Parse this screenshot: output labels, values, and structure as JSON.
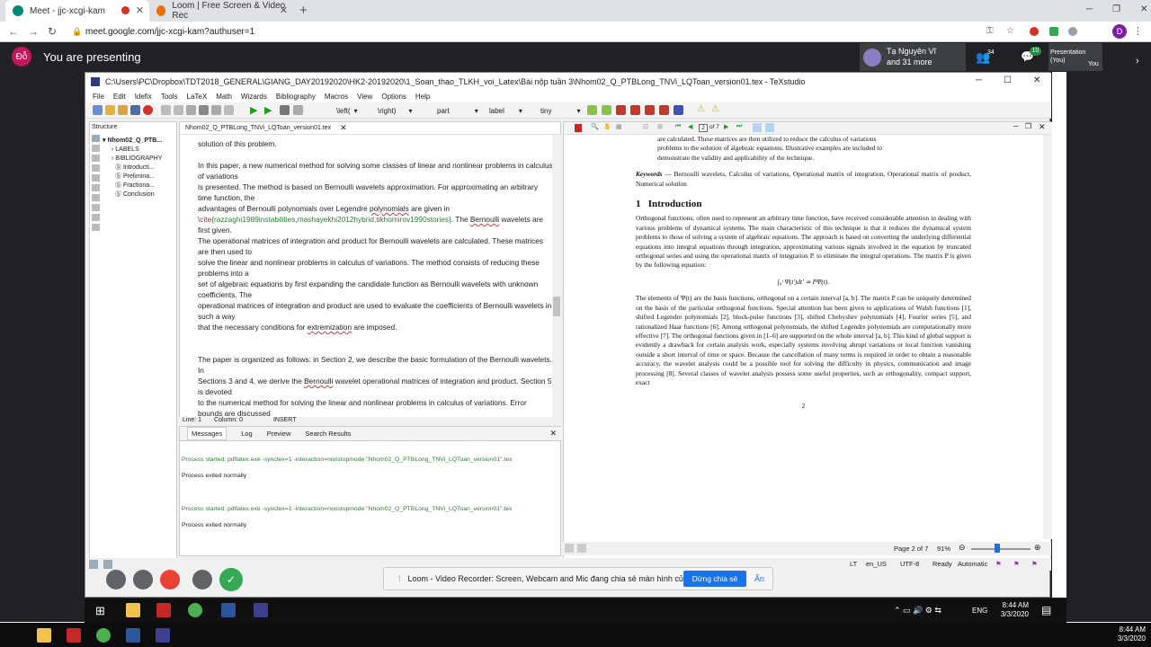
{
  "browser": {
    "tabs": [
      {
        "label": "Meet - jjc-xcgi-kam",
        "active": true
      },
      {
        "label": "Loom | Free Screen & Video Rec",
        "active": false
      }
    ],
    "url": "meet.google.com/jjc-xcgi-kam?authuser=1",
    "profile_letter": "D"
  },
  "meet": {
    "presenter_initials": "Đỗ",
    "presenting_text": "You are presenting",
    "participant_name": "Tạ Nguyên Vĩ",
    "participant_more": "and 31 more",
    "people_count": "34",
    "chat_count": "10",
    "presentation_label": "Presentation (You)",
    "you_label": "You"
  },
  "texstudio": {
    "title": "C:\\Users\\PC\\Dropbox\\TDT2018_GENERAL\\GIANG_DAY20192020\\HK2-20192020\\1_Soan_thao_TLKH_voi_Latex\\Bài nộp tuần 3\\Nhom02_Q_PTBLong_TNVi_LQToan_version01.tex - TeXstudio",
    "menu": [
      "File",
      "Edit",
      "Idefix",
      "Tools",
      "LaTeX",
      "Math",
      "Wizards",
      "Bibliography",
      "Macros",
      "View",
      "Options",
      "Help"
    ],
    "toolbar_dropdowns": [
      "\\left(",
      "\\right)",
      "part",
      "label",
      "tiny"
    ],
    "structure": {
      "header": "Structure",
      "root": "Nhom02_Q_PTB...",
      "items": [
        "LABELS",
        "BIBLIOGRAPHY",
        "Introducti...",
        "Prelimina...",
        "Fractiona...",
        "Conclusion"
      ]
    },
    "editor": {
      "tab": "Nhom02_Q_PTBLong_TNVi_LQToan_version01.tex",
      "status_line": "Line: 1",
      "status_col": "Column: 0",
      "status_mode": "INSERT"
    },
    "messages": {
      "tabs": [
        "Messages",
        "Log",
        "Preview",
        "Search Results"
      ],
      "lines": [
        "Process started: pdflatex.exe -synctex=1 -interaction=nonstopmode \"Nhom02_Q_PTBLong_TNVi_LQToan_version01\".tex",
        "Process exited normally",
        "Process started: pdflatex.exe -synctex=1 -interaction=nonstopmode \"Nhom02_Q_PTBLong_TNVi_LQToan_version01\".tex",
        "Process exited normally"
      ]
    },
    "pdf": {
      "page_box": "2",
      "page_of": "of 7",
      "status_page": "Page 2 of 7",
      "zoom": "91%",
      "abstract_end": [
        "are calculated. These matrices are then utilized to reduce the calculus of variations",
        "problems to the solution of algebraic equations. Illustrative examples are included to",
        "demonstrate the validity and applicability of the technique."
      ],
      "keywords_label": "Keywords",
      "keywords": "— Bernoulli wavelets, Calculus of variations, Operational matrix of integration, Operational matrix of product, Numerical solution",
      "section_num": "1",
      "section_title": "Introduction",
      "para1": "Orthogonal functions, often used to represent an arbitrary time function, have received considerable attention in dealing with various problems of dynamical systems. The main characteristic of this technique is that it reduces the dynamical system problems to those of solving a system of algebraic equations. The approach is based on converting the underlying differential equations into integral equations through integration, approximating various signals involved in the equation by truncated orthogonal series and using the operational matrix of integration P. to eliminate the integral operations. The matrix P is given by the following equation:",
      "equation": "∫₀ᵗ Ψ(t′)dt′ ≃ PΨ(t).",
      "para2": "The elements of Ψ(t) are the basis functions, orthogonal on a certain interval [a, b]. The matrix P can be uniquely determined on the basis of the particular orthogonal functions. Special attention has been given to applications of Walsh functions [1], shifted Legendre polynomials [2], block-pulse functions [3], shifted Chebyshev polynomials [4], Fourier series [5], and rationalized Haar functions [6]. Among orthogonal polynomials, the shifted Legendre polynomials are computationally more effective [7]. The orthogonal functions given in [1–6] are supported on the whole interval [a, b]. This kind of global support is evidently a drawback for certain analysis work, especially systems involving abrupt variations or local function vanishing outside a short interval of time or space. Because the cancellation of many terms is required in order to obtain a reasonable accuracy, the wavelet analysis could be a possible tool for solving the difficulty in physics, communication and image processing [8]. Several classes of wavelet analysis possess some useful properties, such as orthogonality, compact support, exact",
      "page_number": "2"
    },
    "footer": {
      "lang": "en_US",
      "encoding": "UTF-8",
      "ready": "Ready",
      "automatic": "Automatic"
    }
  },
  "loom": {
    "text": "Loom - Video Recorder: Screen, Webcam and Mic đang chia sẻ màn hình của bạn.",
    "stop_button": "Dừng chia sẻ",
    "hide_link": "Ẩn"
  },
  "taskbar": {
    "lang": "ENG",
    "time": "8:44 AM",
    "date": "3/3/2020"
  }
}
